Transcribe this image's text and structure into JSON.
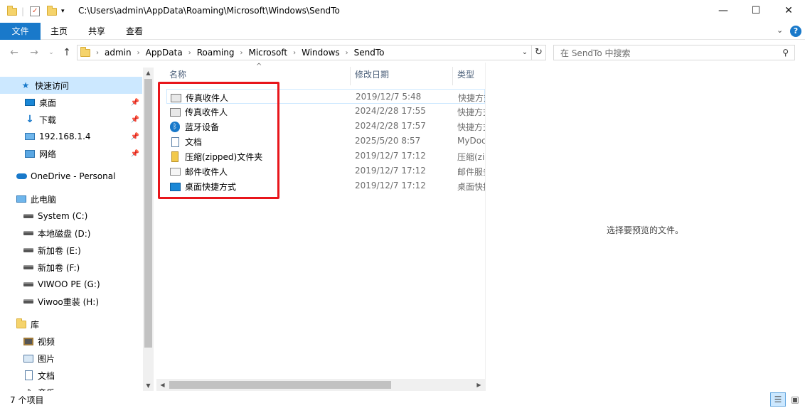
{
  "window": {
    "path_title": "C:\\Users\\admin\\AppData\\Roaming\\Microsoft\\Windows\\SendTo",
    "minimize": "—",
    "maximize": "☐",
    "close": "✕"
  },
  "ribbon": {
    "tabs": [
      "文件",
      "主页",
      "共享",
      "查看"
    ]
  },
  "address": {
    "crumbs": [
      "admin",
      "AppData",
      "Roaming",
      "Microsoft",
      "Windows",
      "SendTo"
    ],
    "search_placeholder": "在 SendTo 中搜索"
  },
  "nav": {
    "quick_access": "快速访问",
    "items": [
      {
        "label": "桌面",
        "pinned": true
      },
      {
        "label": "下载",
        "pinned": true
      },
      {
        "label": "192.168.1.4",
        "pinned": true
      },
      {
        "label": "网络",
        "pinned": true
      }
    ],
    "onedrive": "OneDrive - Personal",
    "this_pc": "此电脑",
    "drives": [
      "System (C:)",
      "本地磁盘 (D:)",
      "新加卷 (E:)",
      "新加卷 (F:)",
      "VIWOO PE (G:)",
      "Viwoo重装 (H:)"
    ],
    "library": "库",
    "library_items": [
      "视频",
      "图片",
      "文档",
      "音乐"
    ]
  },
  "list": {
    "headers": {
      "name": "名称",
      "date": "修改日期",
      "type": "类型"
    },
    "files": [
      {
        "name": "传真收件人",
        "date": "2019/12/7 5:48",
        "type": "快捷方式"
      },
      {
        "name": "传真收件人",
        "date": "2024/2/28 17:55",
        "type": "快捷方式"
      },
      {
        "name": "蓝牙设备",
        "date": "2024/2/28 17:57",
        "type": "快捷方式"
      },
      {
        "name": "文档",
        "date": "2025/5/20 8:57",
        "type": "MyDocs"
      },
      {
        "name": "压缩(zipped)文件夹",
        "date": "2019/12/7 17:12",
        "type": "压缩(zipped)"
      },
      {
        "name": "邮件收件人",
        "date": "2019/12/7 17:12",
        "type": "邮件服务"
      },
      {
        "name": "桌面快捷方式",
        "date": "2019/12/7 17:12",
        "type": "桌面快捷方式"
      }
    ]
  },
  "preview": {
    "empty_text": "选择要预览的文件。"
  },
  "status": {
    "count": "7 个项目"
  },
  "colors": {
    "accent": "#1979ca",
    "selection": "#cce8ff",
    "highlight_box": "#e8151b"
  }
}
